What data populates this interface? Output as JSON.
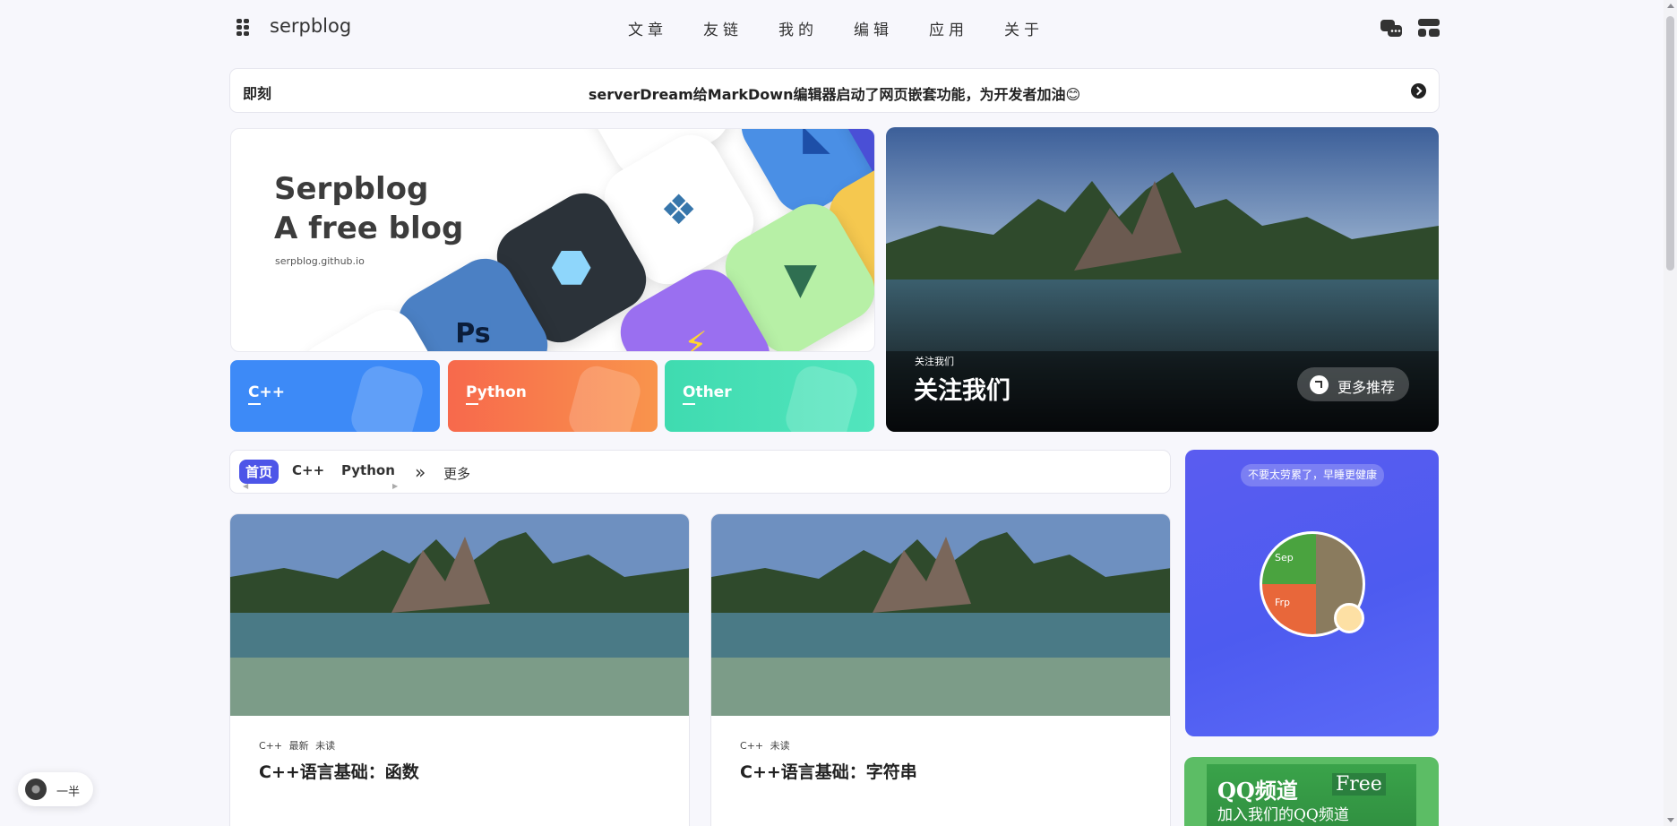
{
  "header": {
    "site_title": "serpblog",
    "nav": [
      "文章",
      "友链",
      "我的",
      "编辑",
      "应用",
      "关于"
    ]
  },
  "announcement": {
    "label": "即刻",
    "text": "serverDream给MarkDown编辑器启动了网页嵌套功能，为开发者加油😊"
  },
  "banner": {
    "title_line1": "Serpblog",
    "title_line2": "A free blog",
    "url": "serpblog.github.io"
  },
  "categories": [
    {
      "label": "C++",
      "color": "#3d8af7"
    },
    {
      "label": "Python",
      "color": "#f7694c"
    },
    {
      "label": "Other",
      "color": "#3fdbb0"
    }
  ],
  "hero": {
    "small": "关注我们",
    "big": "关注我们",
    "more": "更多推荐"
  },
  "tabs": {
    "items": [
      "首页",
      "C++",
      "Python"
    ],
    "more": "更多"
  },
  "posts": [
    {
      "tags": "C++ 最新 未读",
      "title": "C++语言基础：函数"
    },
    {
      "tags": "C++ 未读",
      "title": "C++语言基础：字符串"
    }
  ],
  "sidebar": {
    "profile_pill": "不要太劳累了，早睡更健康",
    "qq_title": "QQ频道",
    "qq_free": "Free",
    "qq_sub": "加入我们的QQ频道"
  },
  "player": {
    "label": "一半"
  },
  "colors": {
    "accent": "#4d55e8",
    "background": "#f7f7fc"
  }
}
